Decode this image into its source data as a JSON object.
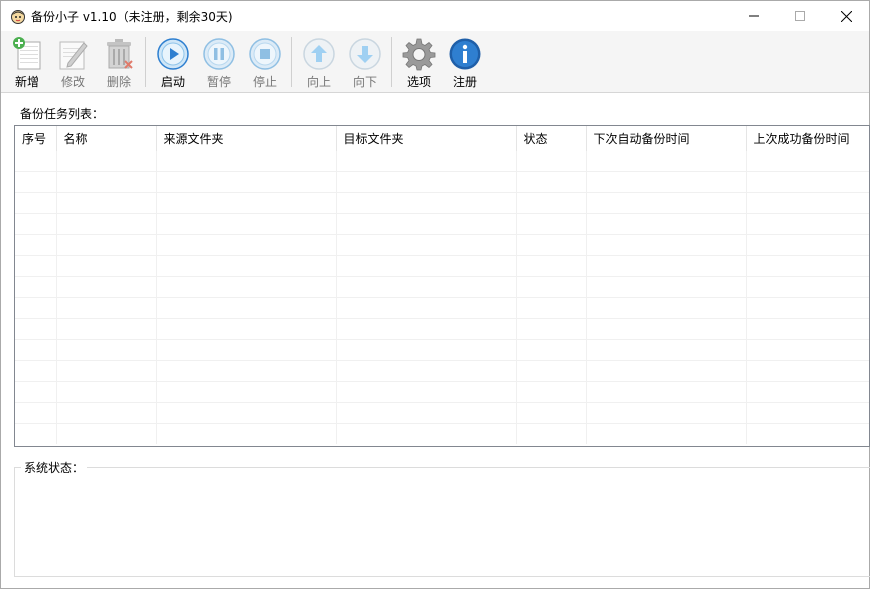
{
  "window": {
    "title": "备份小子 v1.10（未注册，剩余30天)",
    "minimize_icon": "minimize-icon",
    "maximize_icon": "maximize-icon",
    "close_icon": "close-icon"
  },
  "toolbar": {
    "buttons": [
      {
        "label": "新增",
        "icon": "add-icon",
        "enabled": true
      },
      {
        "label": "修改",
        "icon": "edit-icon",
        "enabled": false
      },
      {
        "label": "删除",
        "icon": "delete-icon",
        "enabled": false
      },
      {
        "label": "启动",
        "icon": "play-icon",
        "enabled": true
      },
      {
        "label": "暂停",
        "icon": "pause-icon",
        "enabled": false
      },
      {
        "label": "停止",
        "icon": "stop-icon",
        "enabled": false
      },
      {
        "label": "向上",
        "icon": "arrow-up-icon",
        "enabled": false
      },
      {
        "label": "向下",
        "icon": "arrow-down-icon",
        "enabled": false
      },
      {
        "label": "选项",
        "icon": "gear-icon",
        "enabled": true
      },
      {
        "label": "注册",
        "icon": "info-icon",
        "enabled": true
      }
    ]
  },
  "task_list": {
    "label": "备份任务列表：",
    "columns": [
      "序号",
      "名称",
      "来源文件夹",
      "目标文件夹",
      "状态",
      "下次自动备份时间",
      "上次成功备份时间"
    ],
    "rows": []
  },
  "status": {
    "label": "系统状态："
  },
  "colors": {
    "accent_blue": "#2d7fd0",
    "icon_blue_light": "#9fd0f2",
    "disabled_gray": "#9a9a9a",
    "add_green": "#4caf50"
  }
}
